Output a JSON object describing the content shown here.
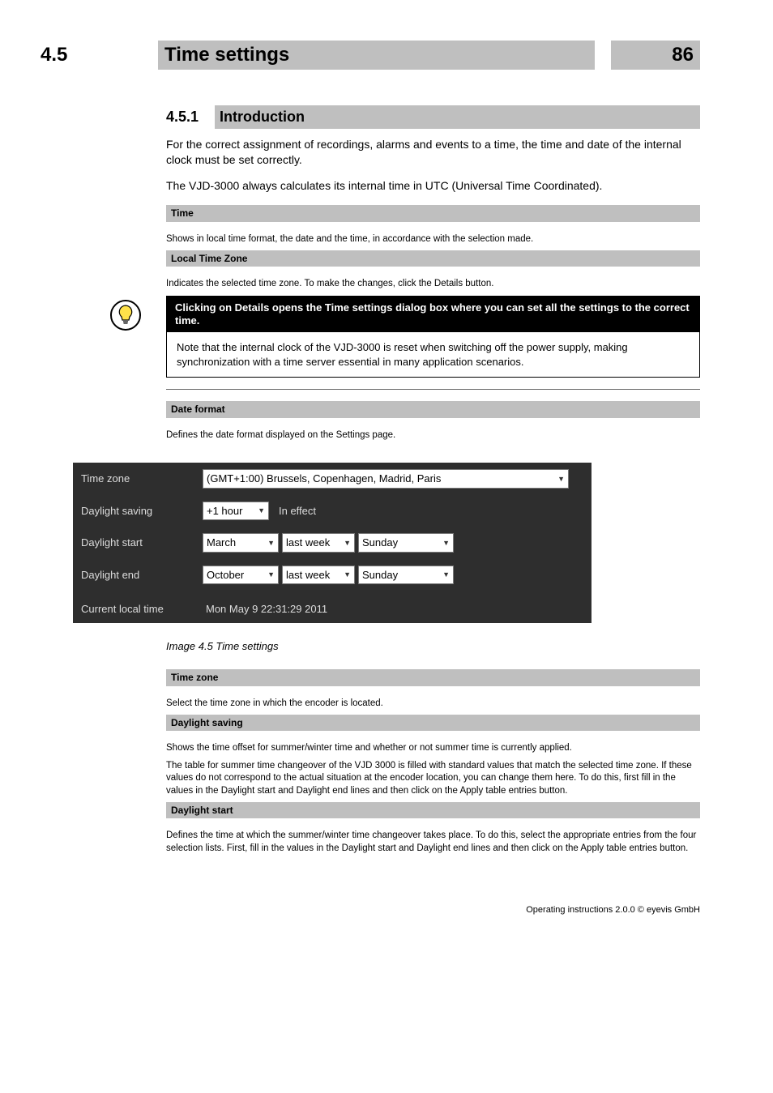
{
  "header": {
    "section_number": "4.5",
    "section_title": "Time settings",
    "page_right": "86"
  },
  "intro": {
    "sub_num": "4.5.1",
    "sub_title": "Introduction",
    "para1": "For the correct assignment of recordings, alarms and events to a time, the time and date of the internal clock must be set correctly.",
    "para2": "The VJD-3000 always calculates its internal time in UTC (Universal Time Coordinated).",
    "time_t": "Time",
    "time_p": "Shows in local time format, the date and the time, in accordance with the selection made.",
    "local_t": "Local Time Zone",
    "local_p": "Indicates the selected time zone. To make the changes, click the Details button.",
    "note_head": "Clicking on Details opens the Time settings dialog box where you can set all the settings to the correct time.",
    "note_body": "Note that the internal clock of the VJD-3000 is reset when switching off the power supply, making synchronization with a time server essential in many application scenarios.",
    "date_t": "Date format",
    "date_p": "Defines the date format displayed on the Settings page."
  },
  "panel": {
    "tz_label": "Time zone",
    "tz_value": "(GMT+1:00) Brussels, Copenhagen, Madrid, Paris",
    "ds_label": "Daylight saving",
    "ds_value": "+1 hour",
    "ds_status": "In effect",
    "dstart_label": "Daylight start",
    "dstart_month": "March",
    "dstart_week": "last week",
    "dstart_day": "Sunday",
    "dend_label": "Daylight end",
    "dend_month": "October",
    "dend_week": "last week",
    "dend_day": "Sunday",
    "clt_label": "Current local time",
    "clt_value": "Mon May 9 22:31:29 2011"
  },
  "after_panel": {
    "ie_note": "Image 4.5 Time settings",
    "tz_t": "Time zone",
    "tz_p": "Select the time zone in which the encoder is located.",
    "saving_t": "Daylight saving",
    "saving_p1": "Shows the time offset for summer/winter time and whether or not summer time is currently applied.",
    "saving_p2": "The table for summer time changeover of the VJD 3000 is filled with standard values that match the selected time zone. If these values do not correspond to the actual situation at the encoder location, you can change them here. To do this, first fill in the values in the Daylight start and Daylight end lines and then click on the Apply table entries button.",
    "start_t": "Daylight start",
    "start_p": "Defines the time at which the summer/winter time changeover takes place. To do this, select the appropriate entries from the four selection lists. First, fill in the values in the Daylight start and Daylight end lines and then click on the Apply table entries button."
  },
  "footer": {
    "left": "",
    "right": "Operating instructions 2.0.0 © eyevis GmbH"
  }
}
